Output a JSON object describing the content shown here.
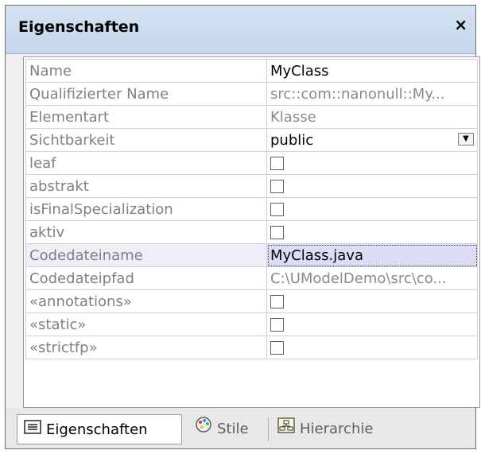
{
  "panel": {
    "title": "Eigenschaften",
    "close_glyph": "×"
  },
  "rows": [
    {
      "name": "Name",
      "value": "MyClass",
      "type": "text"
    },
    {
      "name": "Qualifizierter Name",
      "value": "src::com::nanonull::My...",
      "type": "readonly"
    },
    {
      "name": "Elementart",
      "value": "Klasse",
      "type": "readonly"
    },
    {
      "name": "Sichtbarkeit",
      "value": "public",
      "type": "dropdown"
    },
    {
      "name": "leaf",
      "value": "",
      "type": "checkbox"
    },
    {
      "name": "abstrakt",
      "value": "",
      "type": "checkbox"
    },
    {
      "name": "isFinalSpecialization",
      "value": "",
      "type": "checkbox"
    },
    {
      "name": "aktiv",
      "value": "",
      "type": "checkbox"
    },
    {
      "name": "Codedateiname",
      "value": "MyClass.java",
      "type": "text",
      "selected": true
    },
    {
      "name": "Codedateipfad",
      "value": "C:\\UModelDemo\\src\\co...",
      "type": "readonly"
    },
    {
      "name": "«annotations»",
      "value": "",
      "type": "checkbox"
    },
    {
      "name": "«static»",
      "value": "",
      "type": "checkbox"
    },
    {
      "name": "«strictfp»",
      "value": "",
      "type": "checkbox"
    }
  ],
  "tabs": [
    {
      "label": "Eigenschaften",
      "icon": "properties-icon",
      "active": true
    },
    {
      "label": "Stile",
      "icon": "palette-icon",
      "active": false
    },
    {
      "label": "Hierarchie",
      "icon": "hierarchy-icon",
      "active": false
    }
  ]
}
